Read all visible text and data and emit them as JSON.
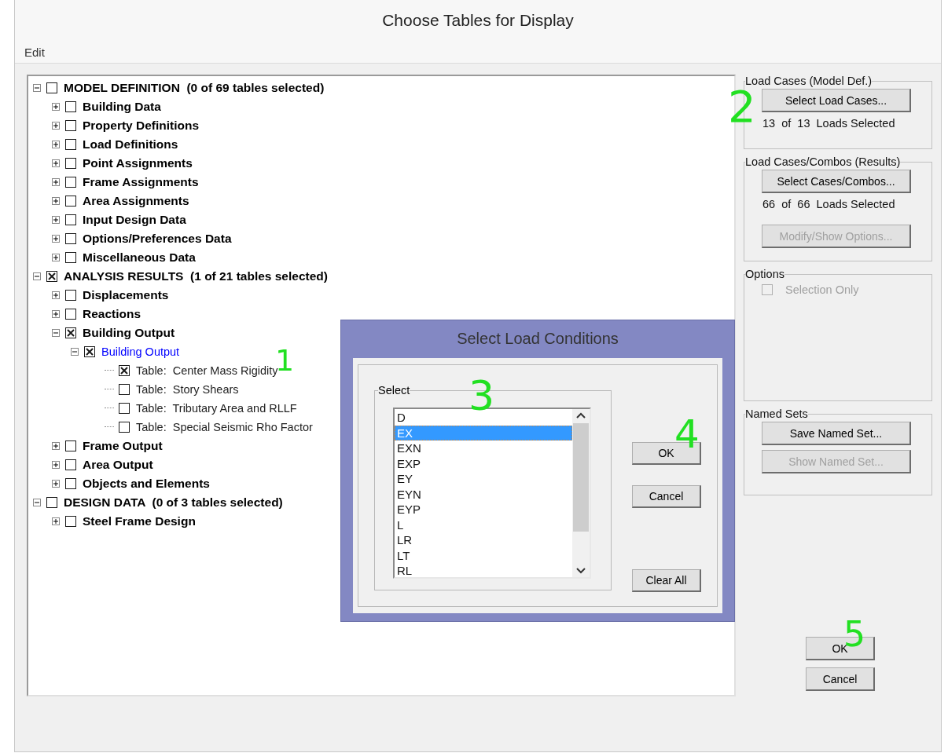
{
  "window": {
    "title": "Choose Tables for Display"
  },
  "menu": [
    {
      "label": "Edit"
    }
  ],
  "tree": [
    {
      "label": "MODEL DEFINITION  (0 of 69 tables selected)",
      "checked": false,
      "expanded": true,
      "selected": false,
      "children": [
        {
          "label": "Building Data",
          "checked": false,
          "expanded": false,
          "selected": false
        },
        {
          "label": "Property Definitions",
          "checked": false,
          "expanded": false,
          "selected": false
        },
        {
          "label": "Load Definitions",
          "checked": false,
          "expanded": false,
          "selected": false
        },
        {
          "label": "Point Assignments",
          "checked": false,
          "expanded": false,
          "selected": false
        },
        {
          "label": "Frame Assignments",
          "checked": false,
          "expanded": false,
          "selected": false
        },
        {
          "label": "Area Assignments",
          "checked": false,
          "expanded": false,
          "selected": false
        },
        {
          "label": "Input Design Data",
          "checked": false,
          "expanded": false,
          "selected": false
        },
        {
          "label": "Options/Preferences Data",
          "checked": false,
          "expanded": false,
          "selected": false
        },
        {
          "label": "Miscellaneous Data",
          "checked": false,
          "expanded": false,
          "selected": false
        }
      ]
    },
    {
      "label": "ANALYSIS RESULTS  (1 of 21 tables selected)",
      "checked": true,
      "expanded": true,
      "selected": false,
      "children": [
        {
          "label": "Displacements",
          "checked": false,
          "expanded": false,
          "selected": false
        },
        {
          "label": "Reactions",
          "checked": false,
          "expanded": false,
          "selected": false
        },
        {
          "label": "Building Output",
          "checked": true,
          "expanded": true,
          "selected": false,
          "children": [
            {
              "label": "Building Output",
              "checked": true,
              "expanded": true,
              "selected": true,
              "children": [
                {
                  "label": "Table:  Center Mass Rigidity",
                  "checked": true,
                  "selected": false
                },
                {
                  "label": "Table:  Story Shears",
                  "checked": false,
                  "selected": false
                },
                {
                  "label": "Table:  Tributary Area and RLLF",
                  "checked": false,
                  "selected": false
                },
                {
                  "label": "Table:  Special Seismic Rho Factor",
                  "checked": false,
                  "selected": false
                }
              ]
            }
          ]
        },
        {
          "label": "Frame Output",
          "checked": false,
          "expanded": false,
          "selected": false
        },
        {
          "label": "Area Output",
          "checked": false,
          "expanded": false,
          "selected": false
        },
        {
          "label": "Objects and Elements",
          "checked": false,
          "expanded": false,
          "selected": false
        }
      ]
    },
    {
      "label": "DESIGN DATA  (0 of 3 tables selected)",
      "checked": false,
      "expanded": true,
      "selected": false,
      "children": [
        {
          "label": "Steel Frame Design",
          "checked": false,
          "expanded": false,
          "selected": false
        }
      ]
    }
  ],
  "side_panel": {
    "groups": [
      {
        "title": "Load Cases (Model Def.)",
        "items": [
          {
            "kind": "button",
            "label": "Select Load Cases...",
            "disabled": false
          },
          {
            "kind": "text",
            "text": "13  of  13  Loads Selected"
          }
        ]
      },
      {
        "title": "Load Cases/Combos (Results)",
        "items": [
          {
            "kind": "button",
            "label": "Select Cases/Combos...",
            "disabled": false
          },
          {
            "kind": "text",
            "text": "66  of  66  Loads Selected"
          },
          {
            "kind": "button",
            "label": "Modify/Show Options...",
            "disabled": true
          }
        ]
      },
      {
        "title": "Options",
        "items": [
          {
            "kind": "checkbox",
            "label": "Selection Only",
            "checked": false,
            "disabled": true
          }
        ]
      },
      {
        "title": "Named Sets",
        "items": [
          {
            "kind": "button",
            "label": "Save Named Set...",
            "disabled": false
          },
          {
            "kind": "button",
            "label": "Show Named Set...",
            "disabled": true
          }
        ]
      }
    ],
    "buttons": [
      {
        "label": "OK"
      },
      {
        "label": "Cancel"
      }
    ]
  },
  "dialog": {
    "title": "Select Load Conditions",
    "group_title": "Select",
    "items": [
      {
        "label": "D",
        "selected": false
      },
      {
        "label": "EX",
        "selected": true
      },
      {
        "label": "EXN",
        "selected": false
      },
      {
        "label": "EXP",
        "selected": false
      },
      {
        "label": "EY",
        "selected": false
      },
      {
        "label": "EYN",
        "selected": false
      },
      {
        "label": "EYP",
        "selected": false
      },
      {
        "label": "L",
        "selected": false
      },
      {
        "label": "LR",
        "selected": false
      },
      {
        "label": "LT",
        "selected": false
      },
      {
        "label": "RL",
        "selected": false
      }
    ],
    "buttons": [
      {
        "label": "OK"
      },
      {
        "label": "Cancel"
      },
      {
        "label": "Clear All"
      }
    ]
  },
  "annotations": [
    {
      "text": "1"
    },
    {
      "text": "2"
    },
    {
      "text": "3"
    },
    {
      "text": "4"
    },
    {
      "text": "5"
    }
  ]
}
